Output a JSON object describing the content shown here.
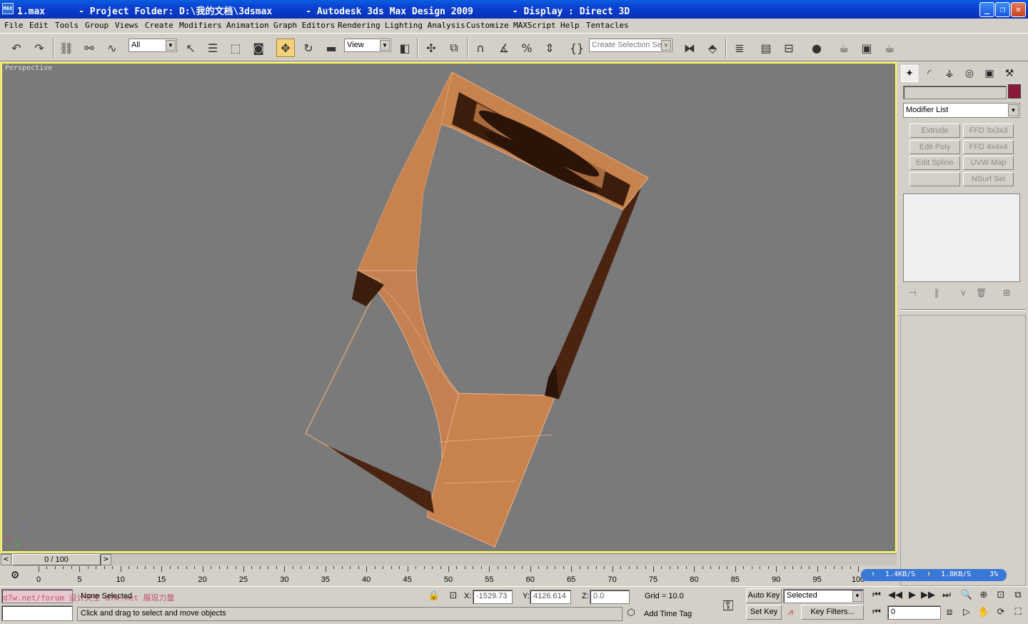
{
  "window": {
    "title": "1.max      - Project Folder: D:\\我的文档\\3dsmax      - Autodesk 3ds Max Design 2009       - Display : Direct 3D",
    "app_icon": "MAX"
  },
  "menu": [
    "File",
    "Edit",
    "Tools",
    "Group",
    "Views",
    "Create",
    "Modifiers",
    "Animation",
    "Graph Editors",
    "Rendering",
    "Lighting Analysis",
    "Customize",
    "MAXScript",
    "Help",
    "Tentacles"
  ],
  "toolbar": {
    "selection_filter": "All",
    "ref_coord": "View",
    "named_selection_placeholder": "Create Selection Set"
  },
  "viewport": {
    "label": "Perspective",
    "axis_x": "x",
    "axis_y": "y",
    "axis_z": "z"
  },
  "command_panel": {
    "modifier_list": "Modifier List",
    "object_color": "#8b1a3a",
    "modifier_buttons": [
      "Extrude",
      "FFD 3x3x3",
      "Edit Poly",
      "FFD 4x4x4",
      "Edit Spline",
      "UVW Map",
      "",
      "NSurf Sel"
    ]
  },
  "time_slider": {
    "frame": "0 / 100"
  },
  "track_bar": {
    "ticks": [
      0,
      5,
      10,
      15,
      20,
      25,
      30,
      35,
      40,
      45,
      50,
      55,
      60,
      65,
      70,
      75,
      80,
      85,
      90,
      95,
      100
    ]
  },
  "netspeed": {
    "down": "1.4KB/S",
    "up": "1.8KB/S",
    "pct": "3%"
  },
  "status": {
    "selection": "None Selected",
    "watermark": "d7w.net/forum 设计天空 d7w.net 展现力量",
    "prompt": "Click and drag to select and move objects",
    "x_value": "-1529.73",
    "y_value": "4126.614",
    "z_value": "0.0",
    "x_label": "X:",
    "y_label": "Y:",
    "z_label": "Z:",
    "grid": "Grid = 10.0",
    "add_time_tag": "Add Time Tag",
    "auto_key": "Auto Key",
    "set_key": "Set Key",
    "key_mode": "Selected",
    "key_filters": "Key Filters...",
    "current_frame": "0"
  }
}
